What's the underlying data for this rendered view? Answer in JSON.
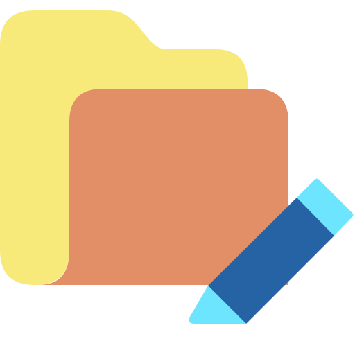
{
  "icon": {
    "name": "edit-folder-icon",
    "colors": {
      "folder_back": "#F7E97A",
      "folder_front": "#E28E66",
      "pencil_body": "#2563A5",
      "pencil_accent": "#6EE5FF"
    }
  }
}
